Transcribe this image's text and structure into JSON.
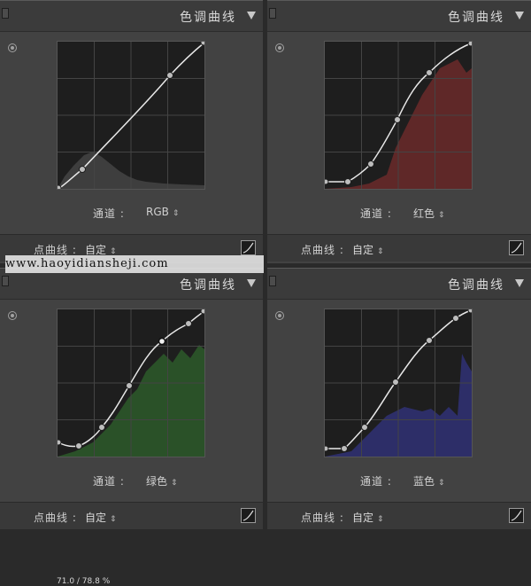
{
  "watermark": "www.haoyidiansheji.com",
  "panels": [
    {
      "title": "色调曲线",
      "channel_label": "通道 :",
      "channel_value": "RGB",
      "pointcurve_label": "点曲线 :",
      "pointcurve_value": "自定",
      "curve_color": "#e8e8e8",
      "histogram_color": "#555555"
    },
    {
      "title": "色调曲线",
      "channel_label": "通道 :",
      "channel_value": "红色",
      "pointcurve_label": "点曲线 :",
      "pointcurve_value": "自定",
      "curve_color": "#e8e8e8",
      "histogram_color": "#6b2a2a"
    },
    {
      "title": "色调曲线",
      "channel_label": "通道 :",
      "channel_value": "绿色",
      "pointcurve_label": "点曲线 :",
      "pointcurve_value": "自定",
      "readout": "71.0 / 78.8 %",
      "curve_color": "#e8e8e8",
      "histogram_color": "#2d5a2a"
    },
    {
      "title": "色调曲线",
      "channel_label": "通道 :",
      "channel_value": "蓝色",
      "pointcurve_label": "点曲线 :",
      "pointcurve_value": "自定",
      "curve_color": "#e8e8e8",
      "histogram_color": "#2f3070"
    }
  ],
  "icons": {
    "collapse": "triangle-down-icon",
    "target": "target-adjust-icon",
    "updown": "updown-arrows-icon",
    "curve_toggle": "curve-edit-icon"
  }
}
